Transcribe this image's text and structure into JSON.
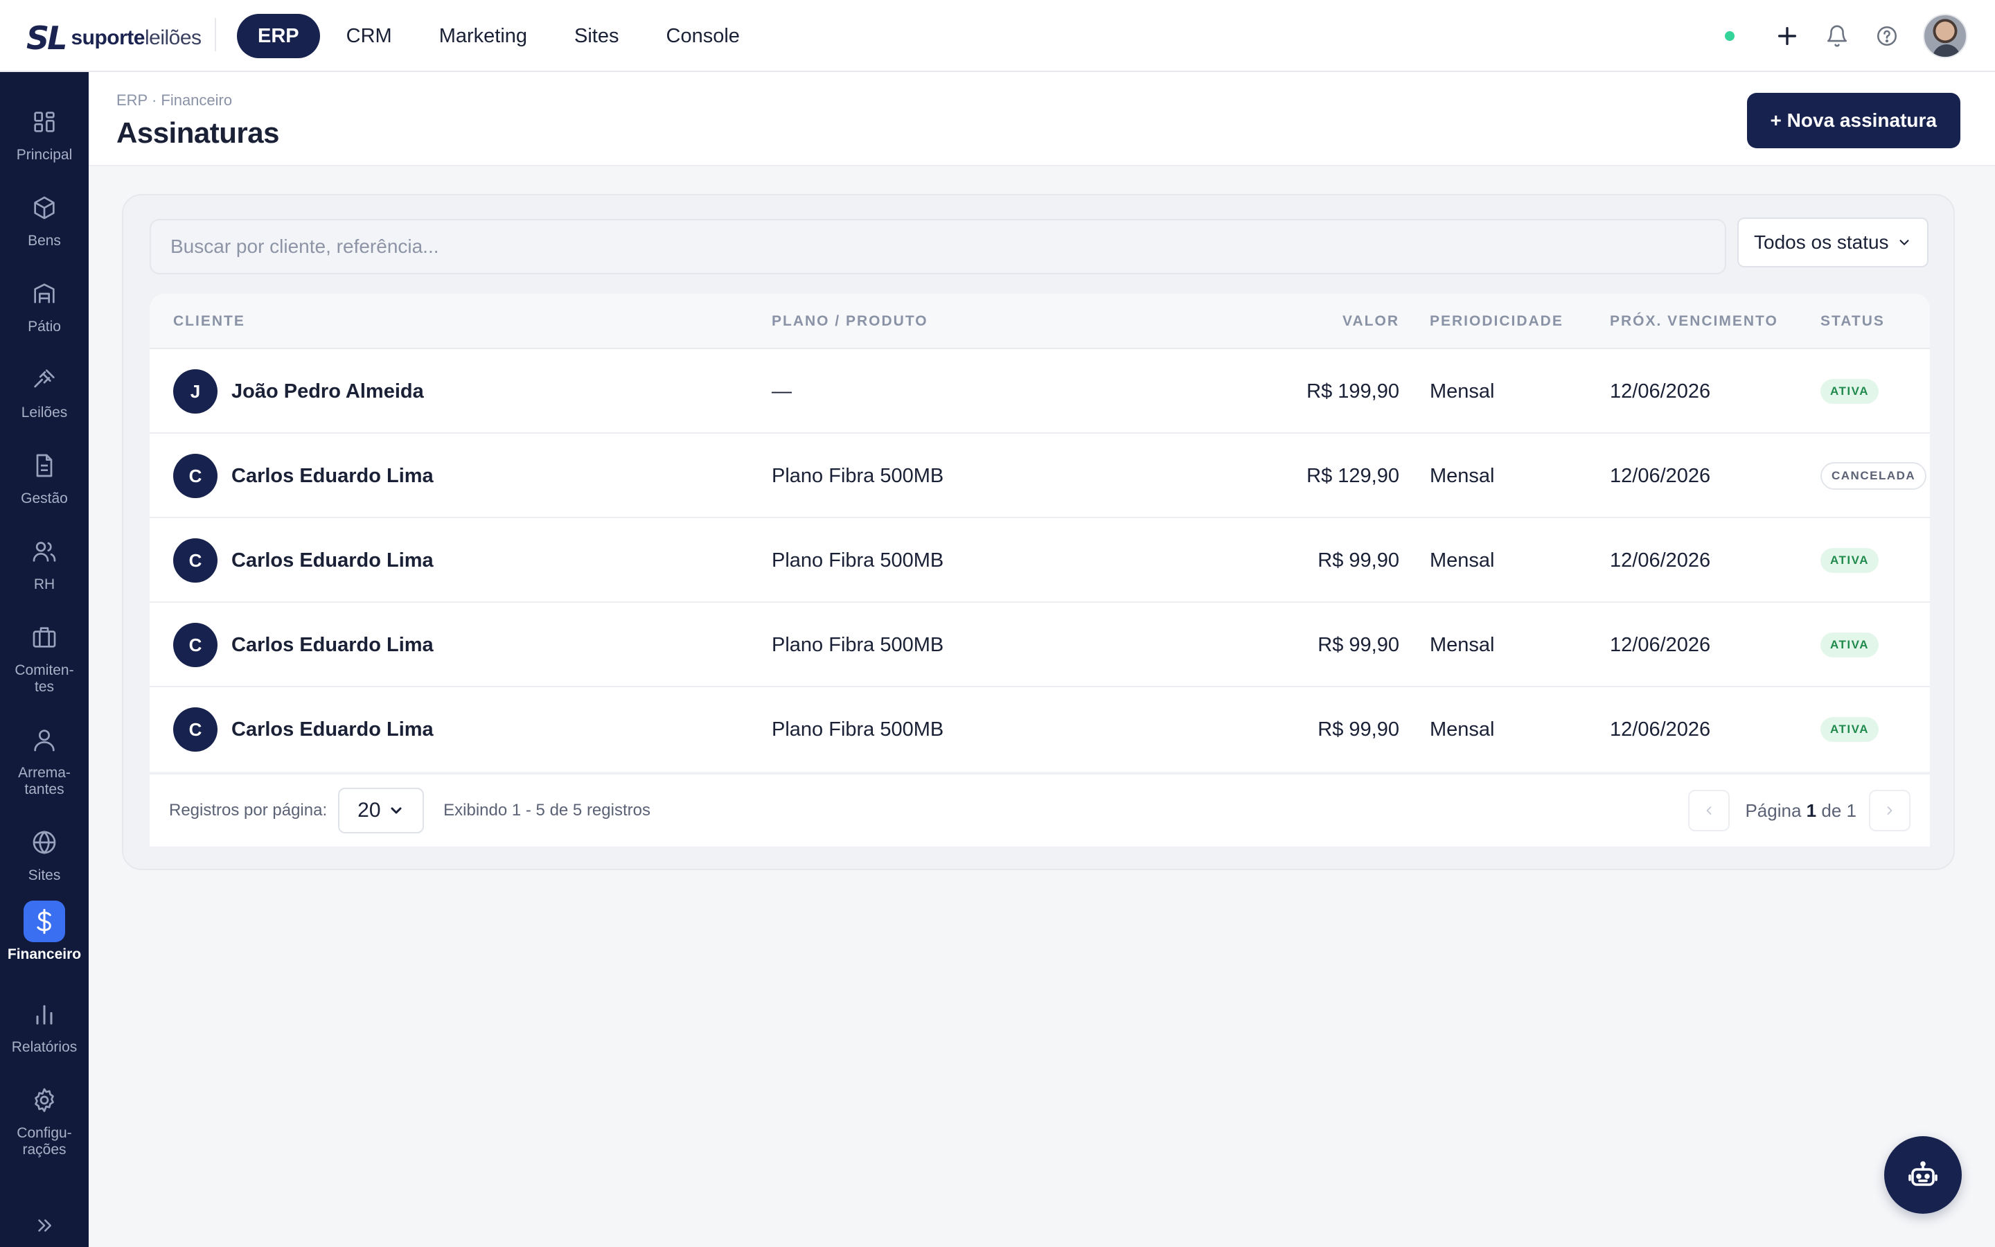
{
  "brand": {
    "mark": "SL",
    "name_bold": "suporte",
    "name_light": "leilões"
  },
  "topnav": [
    {
      "label": "ERP",
      "active": true
    },
    {
      "label": "CRM",
      "active": false
    },
    {
      "label": "Marketing",
      "active": false
    },
    {
      "label": "Sites",
      "active": false
    },
    {
      "label": "Console",
      "active": false
    }
  ],
  "colors": {
    "primary": "#17224e",
    "sidebar": "#111a3a",
    "accent": "#3b6ff2",
    "online": "#34d399",
    "active_badge": "#1f8a4c"
  },
  "sidebar": [
    {
      "label": "Principal",
      "icon": "grid-icon"
    },
    {
      "label": "Bens",
      "icon": "box-icon"
    },
    {
      "label": "Pátio",
      "icon": "warehouse-icon"
    },
    {
      "label": "Leilões",
      "icon": "gavel-icon"
    },
    {
      "label": "Gestão",
      "icon": "document-icon"
    },
    {
      "label": "RH",
      "icon": "users-icon"
    },
    {
      "label": "Comiten-\ntes",
      "icon": "briefcase-icon"
    },
    {
      "label": "Arrema-\ntantes",
      "icon": "user-icon"
    },
    {
      "label": "Sites",
      "icon": "globe-icon"
    },
    {
      "label": "Financeiro",
      "icon": "dollar-icon",
      "active": true
    },
    {
      "label": "Relatórios",
      "icon": "bar-chart-icon"
    },
    {
      "label": "Configu-\nrações",
      "icon": "gear-icon"
    }
  ],
  "header": {
    "breadcrumb": "ERP · Financeiro",
    "title": "Assinaturas",
    "new_button": "+ Nova assinatura"
  },
  "filters": {
    "search_placeholder": "Buscar por cliente, referência...",
    "status_selected": "Todos os status"
  },
  "table": {
    "columns": [
      "Cliente",
      "Plano / Produto",
      "Valor",
      "Periodicidade",
      "Próx. Vencimento",
      "Status"
    ],
    "rows": [
      {
        "initial": "J",
        "client": "João Pedro Almeida",
        "plan": "—",
        "value": "R$ 199,90",
        "period": "Mensal",
        "due": "12/06/2026",
        "status": "ATIVA",
        "status_kind": "ativa"
      },
      {
        "initial": "C",
        "client": "Carlos Eduardo Lima",
        "plan": "Plano Fibra 500MB",
        "value": "R$ 129,90",
        "period": "Mensal",
        "due": "12/06/2026",
        "status": "CANCELADA",
        "status_kind": "cancelada"
      },
      {
        "initial": "C",
        "client": "Carlos Eduardo Lima",
        "plan": "Plano Fibra 500MB",
        "value": "R$ 99,90",
        "period": "Mensal",
        "due": "12/06/2026",
        "status": "ATIVA",
        "status_kind": "ativa"
      },
      {
        "initial": "C",
        "client": "Carlos Eduardo Lima",
        "plan": "Plano Fibra 500MB",
        "value": "R$ 99,90",
        "period": "Mensal",
        "due": "12/06/2026",
        "status": "ATIVA",
        "status_kind": "ativa"
      },
      {
        "initial": "C",
        "client": "Carlos Eduardo Lima",
        "plan": "Plano Fibra 500MB",
        "value": "R$ 99,90",
        "period": "Mensal",
        "due": "12/06/2026",
        "status": "ATIVA",
        "status_kind": "ativa"
      }
    ]
  },
  "footer": {
    "per_page_label": "Registros por página:",
    "per_page_value": "20",
    "showing": "Exibindo 1 - 5 de 5 registros",
    "page_prefix": "Página",
    "page_current": "1",
    "page_sep": "de",
    "page_total": "1"
  }
}
